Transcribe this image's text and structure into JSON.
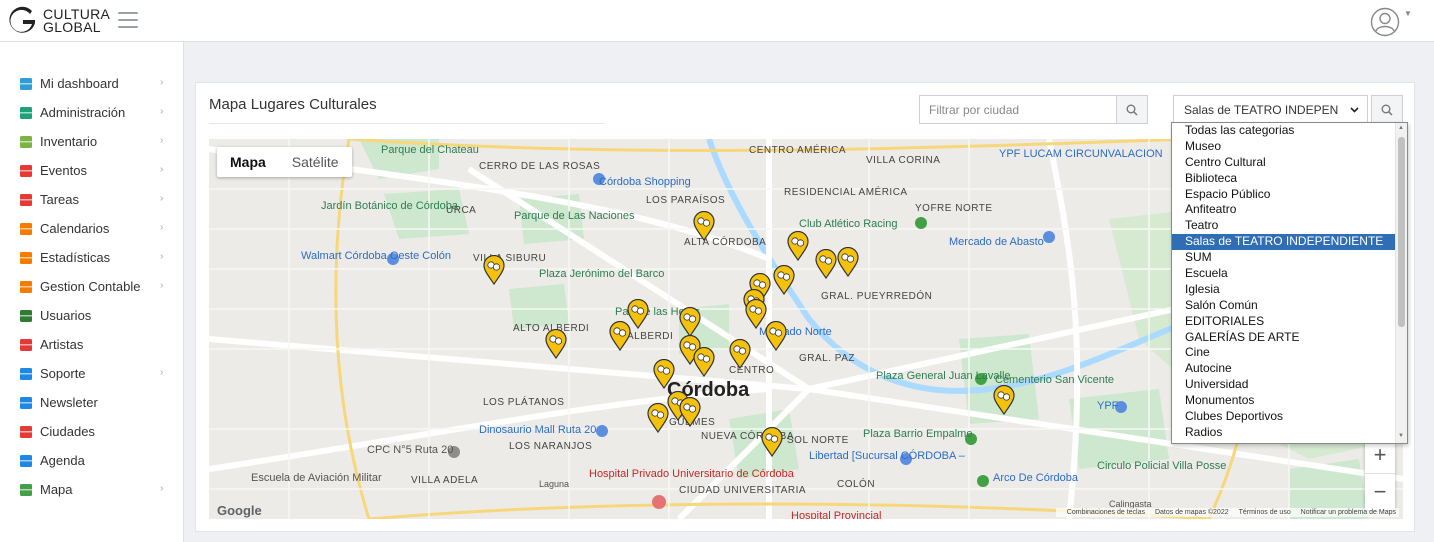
{
  "brand": {
    "line1": "CULTURA",
    "line2": "GLOBAL"
  },
  "sidebar": {
    "items": [
      {
        "label": "Mi dashboard",
        "icon": "dashboard-icon",
        "color": "#2e9fd6",
        "arrow": true
      },
      {
        "label": "Administración",
        "icon": "admin-table-icon",
        "color": "#1aa37a",
        "arrow": true
      },
      {
        "label": "Inventario",
        "icon": "inventory-icon",
        "color": "#7cb342",
        "arrow": true
      },
      {
        "label": "Eventos",
        "icon": "calendar-event-icon",
        "color": "#e53935",
        "arrow": true
      },
      {
        "label": "Tareas",
        "icon": "tasks-icon",
        "color": "#e53935",
        "arrow": true
      },
      {
        "label": "Calendarios",
        "icon": "calendar-icon",
        "color": "#f57c00",
        "arrow": true
      },
      {
        "label": "Estadísticas",
        "icon": "stats-icon",
        "color": "#f57c00",
        "arrow": true
      },
      {
        "label": "Gestion Contable",
        "icon": "accounting-icon",
        "color": "#f57c00",
        "arrow": true
      },
      {
        "label": "Usuarios",
        "icon": "user-icon",
        "color": "#2e7d32",
        "arrow": false
      },
      {
        "label": "Artistas",
        "icon": "artist-icon",
        "color": "#e53935",
        "arrow": false
      },
      {
        "label": "Soporte",
        "icon": "support-icon",
        "color": "#1e88e5",
        "arrow": true
      },
      {
        "label": "Newsleter",
        "icon": "megaphone-icon",
        "color": "#1e88e5",
        "arrow": false
      },
      {
        "label": "Ciudades",
        "icon": "cities-icon",
        "color": "#e53935",
        "arrow": false
      },
      {
        "label": "Agenda",
        "icon": "agenda-icon",
        "color": "#1e88e5",
        "arrow": false
      },
      {
        "label": "Mapa",
        "icon": "globe-icon",
        "color": "#43a047",
        "arrow": true
      }
    ]
  },
  "card": {
    "title": "Mapa Lugares Culturales",
    "filter_placeholder": "Filtrar por ciudad",
    "category_value": "Salas de TEATRO INDEPENDIE"
  },
  "map": {
    "tab_map": "Mapa",
    "tab_satellite": "Satélite",
    "google": "Google",
    "footer": [
      "Combinaciones de teclas",
      "Datos de mapas ©2022",
      "Términos de uso",
      "Notificar un problema de Maps"
    ],
    "labels": [
      "Parque del Chateau",
      "CERRO DE LAS ROSAS",
      "Córdoba Shopping",
      "CENTRO AMÉRICA",
      "VILLA CORINA",
      "YPF LUCAM CIRCUNVALACION",
      "Jardín Botánico de Córdoba",
      "URCA",
      "Parque de Las Naciones",
      "LOS PARAÍSOS",
      "RESIDENCIAL AMÉRICA",
      "YOFRE NORTE",
      "Club Atlético Racing",
      "Mercado de Abasto",
      "ALTA CÓRDOBA",
      "Walmart Córdoba Oeste Colón",
      "VILLA SIBURU",
      "Plaza Jerónimo del Barco",
      "GRAL. PUEYRREDÓN",
      "Parque las Heras",
      "ALTO ALBERDI",
      "ALBERDI",
      "Mercado Norte",
      "CENTRO",
      "GRAL. PAZ",
      "Plaza General Juan Lavalle",
      "Cementerio San Vicente",
      "Córdoba",
      "LOS PLÁTANOS",
      "Dinosaurio Mall Ruta 20",
      "LOS NARANJOS",
      "NUEVA CÓRDOBA",
      "GÜEMES",
      "SOL NORTE",
      "Plaza Barrio Empalme",
      "Libertad [Sucursal CÓRDOBA –",
      "CPC N°5 Ruta 20",
      "Escuela de Aviación Militar",
      "VILLA ADELA",
      "Hospital Privado Universitario de Córdoba",
      "CIUDAD UNIVERSITARIA",
      "COLÓN",
      "Hospital Provincial",
      "Arco De Córdoba",
      "Circulo Policial Villa Posse",
      "YPF",
      "Laguna",
      "Calingasta"
    ]
  },
  "dropdown": {
    "options": [
      "Todas las categorias",
      "Museo",
      "Centro Cultural",
      "Biblioteca",
      "Espacio Público",
      "Anfiteatro",
      "Teatro",
      "Salas de TEATRO INDEPENDIENTE",
      "SUM",
      "Escuela",
      "Iglesia",
      "Salón Común",
      "EDITORIALES",
      "GALERÍAS DE ARTE",
      "Cine",
      "Autocine",
      "Universidad",
      "Monumentos",
      "Clubes Deportivos",
      "Radios"
    ],
    "selected": "Salas de TEATRO INDEPENDIENTE"
  },
  "colors": {
    "accent": "#2f6eb5",
    "marker": "#f4c20d",
    "park": "#c8e6c9",
    "water": "#aadaff"
  }
}
